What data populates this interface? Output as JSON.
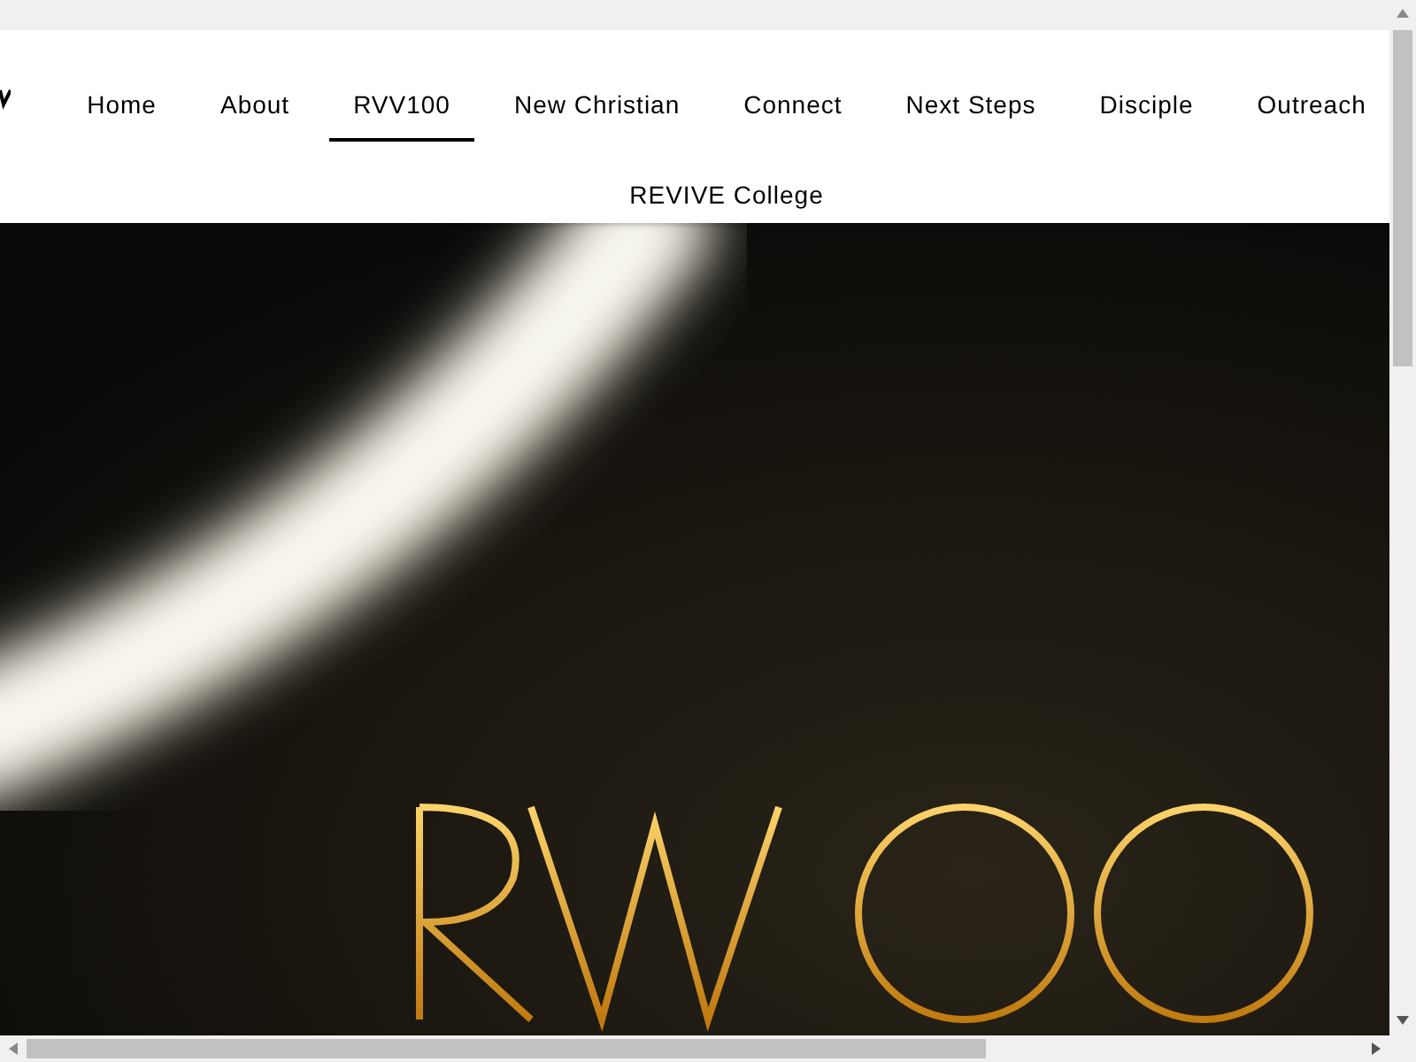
{
  "nav": {
    "items": [
      {
        "label": "Home",
        "selected": false
      },
      {
        "label": "About",
        "selected": false
      },
      {
        "label": "RVV100",
        "selected": true
      },
      {
        "label": "New Christian",
        "selected": false
      },
      {
        "label": "Connect",
        "selected": false
      },
      {
        "label": "Next Steps",
        "selected": false
      },
      {
        "label": "Disciple",
        "selected": false
      },
      {
        "label": "Outreach",
        "selected": false
      },
      {
        "label": "REVIVE College",
        "selected": false
      }
    ]
  }
}
